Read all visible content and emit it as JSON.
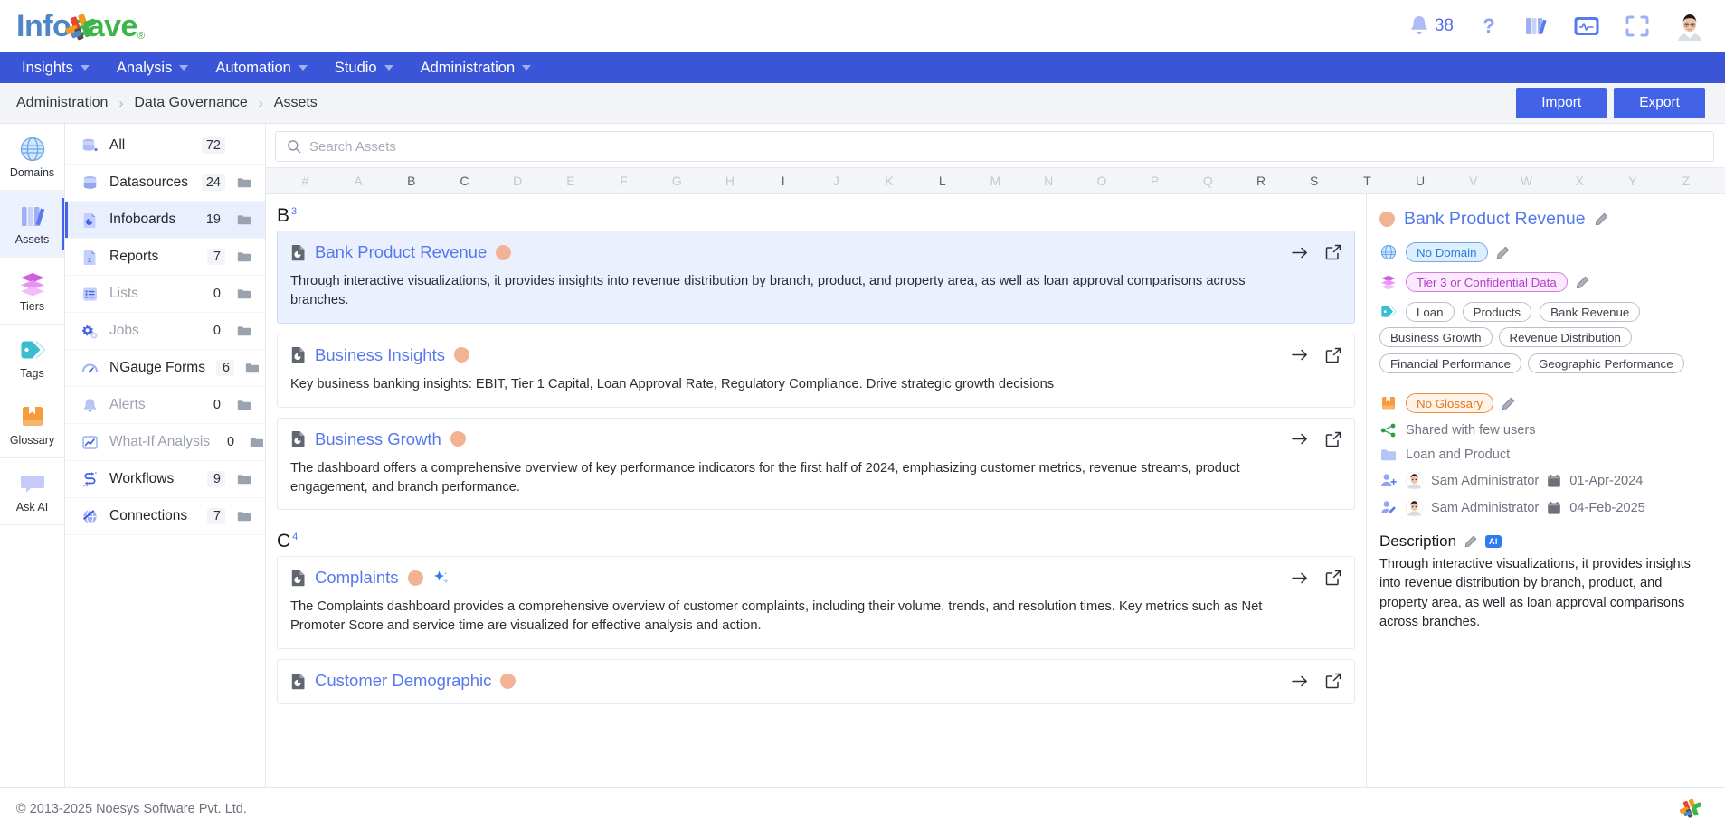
{
  "brand": {
    "name_part1": "Info",
    "name_part2": "eave",
    "registered": "®"
  },
  "header": {
    "notification_count": "38",
    "icons": [
      {
        "name": "notifications-bell-icon",
        "label": "Notifications"
      },
      {
        "name": "help-question-icon",
        "label": "Help"
      },
      {
        "name": "library-books-icon",
        "label": "Library"
      },
      {
        "name": "monitor-activity-icon",
        "label": "Monitoring"
      },
      {
        "name": "fullscreen-icon",
        "label": "Fullscreen"
      },
      {
        "name": "user-avatar",
        "label": "Profile"
      }
    ]
  },
  "nav": {
    "items": [
      {
        "label": "Insights",
        "has_caret": true
      },
      {
        "label": "Analysis",
        "has_caret": true
      },
      {
        "label": "Automation",
        "has_caret": true
      },
      {
        "label": "Studio",
        "has_caret": true
      },
      {
        "label": "Administration",
        "has_caret": true
      }
    ]
  },
  "breadcrumb": {
    "items": [
      "Administration",
      "Data Governance",
      "Assets"
    ],
    "separator": "›",
    "import_label": "Import",
    "export_label": "Export"
  },
  "rail": {
    "items": [
      {
        "label": "Domains",
        "icon": "globe-icon",
        "active": false
      },
      {
        "label": "Assets",
        "icon": "books-icon",
        "active": true
      },
      {
        "label": "Tiers",
        "icon": "layers-icon",
        "active": false
      },
      {
        "label": "Tags",
        "icon": "tag-icon",
        "active": false
      },
      {
        "label": "Glossary",
        "icon": "book-bookmark-icon",
        "active": false
      },
      {
        "label": "Ask AI",
        "icon": "chat-bubble-icon",
        "active": false
      }
    ]
  },
  "asset_types": {
    "items": [
      {
        "label": "All",
        "count": "72",
        "icon": "database-all-icon",
        "active": false,
        "dim": false,
        "folder": false
      },
      {
        "label": "Datasources",
        "count": "24",
        "icon": "database-icon",
        "active": false,
        "dim": false,
        "folder": true
      },
      {
        "label": "Infoboards",
        "count": "19",
        "icon": "infoboard-icon",
        "active": true,
        "dim": false,
        "folder": true
      },
      {
        "label": "Reports",
        "count": "7",
        "icon": "report-file-icon",
        "active": false,
        "dim": false,
        "folder": true
      },
      {
        "label": "Lists",
        "count": "0",
        "icon": "list-icon",
        "active": false,
        "dim": true,
        "folder": true
      },
      {
        "label": "Jobs",
        "count": "0",
        "icon": "gears-icon",
        "active": false,
        "dim": true,
        "folder": true
      },
      {
        "label": "NGauge Forms",
        "count": "6",
        "icon": "gauge-icon",
        "active": false,
        "dim": false,
        "folder": true
      },
      {
        "label": "Alerts",
        "count": "0",
        "icon": "bell-icon",
        "active": false,
        "dim": true,
        "folder": true
      },
      {
        "label": "What-If Analysis",
        "count": "0",
        "icon": "line-chart-icon",
        "active": false,
        "dim": true,
        "folder": true
      },
      {
        "label": "Workflows",
        "count": "9",
        "icon": "workflow-icon",
        "active": false,
        "dim": false,
        "folder": true
      },
      {
        "label": "Connections",
        "count": "7",
        "icon": "connections-globe-icon",
        "active": false,
        "dim": false,
        "folder": true
      }
    ]
  },
  "search": {
    "placeholder": "Search Assets",
    "value": ""
  },
  "alphabet": {
    "letters": [
      "#",
      "A",
      "B",
      "C",
      "D",
      "E",
      "F",
      "G",
      "H",
      "I",
      "J",
      "K",
      "L",
      "M",
      "N",
      "O",
      "P",
      "Q",
      "R",
      "S",
      "T",
      "U",
      "V",
      "W",
      "X",
      "Y",
      "Z"
    ],
    "enabled": [
      "B",
      "C",
      "I",
      "L",
      "R",
      "S",
      "T",
      "U"
    ]
  },
  "groups": [
    {
      "letter": "B",
      "count": "3",
      "cards": [
        {
          "title": "Bank Product Revenue",
          "description": "Through interactive visualizations, it provides insights into revenue distribution by branch, product, and property area, as well as loan approval comparisons across branches.",
          "selected": true,
          "has_ai": false
        },
        {
          "title": "Business Insights",
          "description": "Key business banking insights: EBIT, Tier 1 Capital, Loan Approval Rate, Regulatory Compliance. Drive strategic growth decisions",
          "selected": false,
          "has_ai": false
        },
        {
          "title": "Business Growth",
          "description": "The dashboard offers a comprehensive overview of key performance indicators for the first half of 2024, emphasizing customer metrics, revenue streams, product engagement, and branch performance.",
          "selected": false,
          "has_ai": false
        }
      ]
    },
    {
      "letter": "C",
      "count": "4",
      "cards": [
        {
          "title": "Complaints",
          "description": "The Complaints dashboard provides a comprehensive overview of customer complaints, including their volume, trends, and resolution times. Key metrics such as Net Promoter Score and service time are visualized for effective analysis and action.",
          "selected": false,
          "has_ai": true
        },
        {
          "title": "Customer Demographic",
          "description": "",
          "selected": false,
          "has_ai": false
        }
      ]
    }
  ],
  "detail": {
    "title": "Bank Product Revenue",
    "domain": "No Domain",
    "tier": "Tier 3 or Confidential Data",
    "tags": [
      "Loan",
      "Products",
      "Bank Revenue",
      "Business Growth",
      "Revenue Distribution",
      "Financial Performance",
      "Geographic Performance"
    ],
    "glossary": "No Glossary",
    "shared": "Shared with few users",
    "folder": "Loan and Product",
    "created_by": "Sam Administrator",
    "created_date": "01-Apr-2024",
    "modified_by": "Sam Administrator",
    "modified_date": "04-Feb-2025",
    "description_label": "Description",
    "ai_badge": "AI",
    "description": "Through interactive visualizations, it provides insights into revenue distribution by branch, product, and property area, as well as loan approval comparisons across branches."
  },
  "footer": {
    "copyright": "© 2013-2025 Noesys Software Pvt. Ltd."
  },
  "colors": {
    "accent_blue": "#4262e8",
    "nav_blue": "#3b55d9",
    "link_blue": "#5578ef",
    "tier_orange": "#f2b394",
    "glossary_orange": "#e2761f",
    "tier_purple": "#b43fc8"
  }
}
